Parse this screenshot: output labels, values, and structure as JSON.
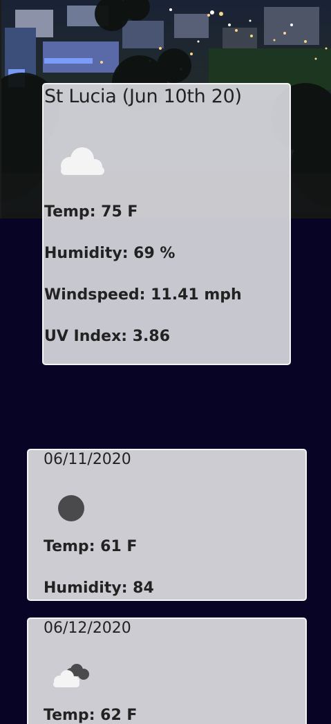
{
  "current": {
    "title": "St Lucia (Jun 10th 20)",
    "icon": "cloud-icon",
    "stats": [
      {
        "label": "Temp",
        "value": "75 F"
      },
      {
        "label": "Humidity",
        "value": "69 %"
      },
      {
        "label": "Windspeed",
        "value": "11.41 mph"
      },
      {
        "label": "UV Index",
        "value": "3.86"
      }
    ]
  },
  "forecast": [
    {
      "date": "06/11/2020",
      "icon": "dark-circle-icon",
      "temp": {
        "label": "Temp",
        "value": "61 F"
      },
      "humidity": {
        "label": "Humidity",
        "value": "84"
      }
    },
    {
      "date": "06/12/2020",
      "icon": "cloud-with-dark-clouds-icon",
      "temp": {
        "label": "Temp",
        "value": "62 F"
      }
    }
  ]
}
